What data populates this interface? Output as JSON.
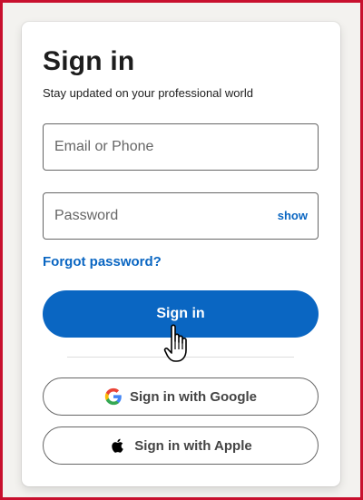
{
  "login": {
    "title": "Sign in",
    "subtitle": "Stay updated on your professional world",
    "email_placeholder": "Email or Phone",
    "email_value": "",
    "password_placeholder": "Password",
    "password_value": "",
    "show_label": "show",
    "forgot_label": "Forgot password?",
    "signin_label": "Sign in",
    "google_label": "Sign in with Google",
    "apple_label": "Sign in with Apple"
  },
  "icons": {
    "google": "google-icon",
    "apple": "apple-icon",
    "cursor": "hand-pointer-cursor-icon"
  },
  "colors": {
    "accent": "#0a66c2",
    "frame": "#c8102e",
    "text": "#1d1d1d",
    "border": "#666666"
  }
}
